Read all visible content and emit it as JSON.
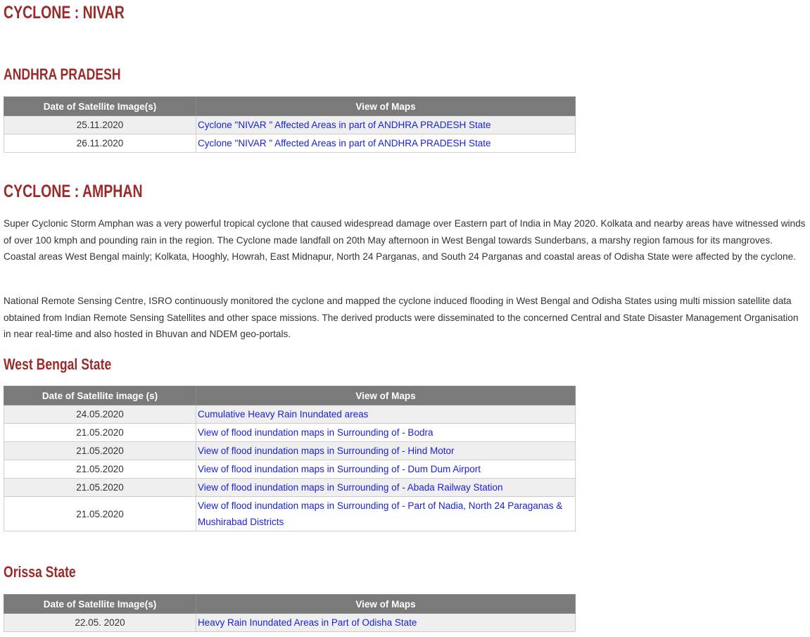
{
  "nivar": {
    "title": "CYCLONE :  NIVAR",
    "state": "ANDHRA PRADESH",
    "headers": [
      "Date of Satellite Image(s)",
      "View of  Maps"
    ],
    "rows": [
      {
        "date": "25.11.2020",
        "link": "Cyclone \"NIVAR \" Affected Areas in part of ANDHRA PRADESH State"
      },
      {
        "date": "26.11.2020",
        "link": "Cyclone \"NIVAR \" Affected Areas in part of ANDHRA PRADESH State"
      }
    ]
  },
  "amphan": {
    "title": "CYCLONE :  AMPHAN",
    "para1": "Super Cyclonic Storm Amphan was a very powerful  tropical cyclone that caused widespread damage over Eastern part of  India in May 2020. Kolkata and nearby areas have witnessed winds of over 100 kmph and pounding rain in the region. The Cyclone made landfall on 20th May afternoon in West Bengal towards Sunderbans, a marshy region famous for its mangroves. Coastal areas West Bengal mainly; Kolkata, Hooghly, Howrah, East Midnapur, North 24 Parganas, and South 24 Parganas and coastal areas of Odisha State were affected by the cyclone.",
    "para2": "National Remote Sensing Centre, ISRO continuously monitored the cyclone and mapped the cyclone induced flooding in West Bengal and Odisha States using multi mission satellite data obtained from Indian Remote Sensing Satellites and other space missions. The derived products were disseminated to the concerned Central and State Disaster Management Organisation in near real-time and also hosted in Bhuvan and NDEM geo-portals.",
    "west_bengal": {
      "state": "West Bengal State",
      "headers": [
        "Date of Satellite image (s)",
        "View of Maps"
      ],
      "rows": [
        {
          "date": "24.05.2020",
          "link": "Cumulative Heavy Rain Inundated areas"
        },
        {
          "date": "21.05.2020",
          "link": "View of flood inundation maps in Surrounding of - Bodra"
        },
        {
          "date": "21.05.2020",
          "link": "View of flood inundation maps in Surrounding of - Hind Motor"
        },
        {
          "date": "21.05.2020",
          "link": "View of flood inundation maps in Surrounding of - Dum Dum Airport"
        },
        {
          "date": "21.05.2020",
          "link": "View of flood inundation maps in Surrounding of - Abada Railway Station"
        },
        {
          "date": "21.05.2020",
          "link": "View of flood inundation maps in Surrounding of - Part of Nadia, North 24 Paraganas & Mushirabad Districts"
        }
      ]
    },
    "orissa": {
      "state": "Orissa State",
      "headers": [
        "Date of Satellite Image(s)",
        "View of  Maps"
      ],
      "rows": [
        {
          "date": "22.05. 2020",
          "link": "Heavy Rain Inundated Areas in Part of Odisha State"
        }
      ]
    }
  },
  "colors": {
    "heading": "#9b2a2a",
    "link": "#1a22d6",
    "header_bg": "#7a7a7a"
  }
}
